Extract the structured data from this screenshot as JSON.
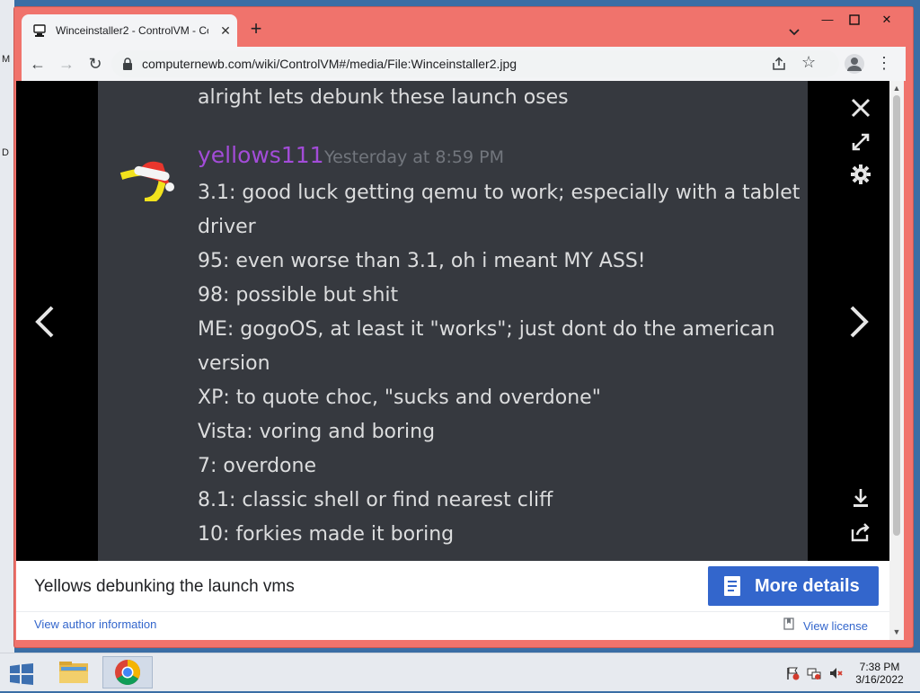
{
  "desktop": {
    "edge_letters": [
      "M",
      "D"
    ]
  },
  "browser": {
    "tab_title": "Winceinstaller2 - ControlVM - Co",
    "url": "computernewb.com/wiki/ControlVM#/media/File:Winceinstaller2.jpg"
  },
  "viewer": {
    "image": {
      "top_line": "alright lets debunk these launch oses",
      "username": "yellows111",
      "timestamp": "Yesterday at 8:59 PM",
      "lines": [
        "3.1: good luck getting qemu to work; especially with a tablet",
        "driver",
        "95: even worse than 3.1, oh i meant MY ASS!",
        "98: possible but shit",
        "ME: gogoOS, at least it \"works\"; just dont do the american",
        "version",
        "XP: to quote choc, \"sucks and overdone\"",
        "Vista: voring and boring",
        "7: overdone",
        "8.1: classic shell or find nearest cliff",
        "10: forkies made it boring"
      ]
    },
    "caption": "Yellows debunking the launch vms",
    "more_details": "More details",
    "author_link": "View author information",
    "license_link": "View license"
  },
  "tray": {
    "time": "7:38 PM",
    "date": "3/16/2022"
  }
}
